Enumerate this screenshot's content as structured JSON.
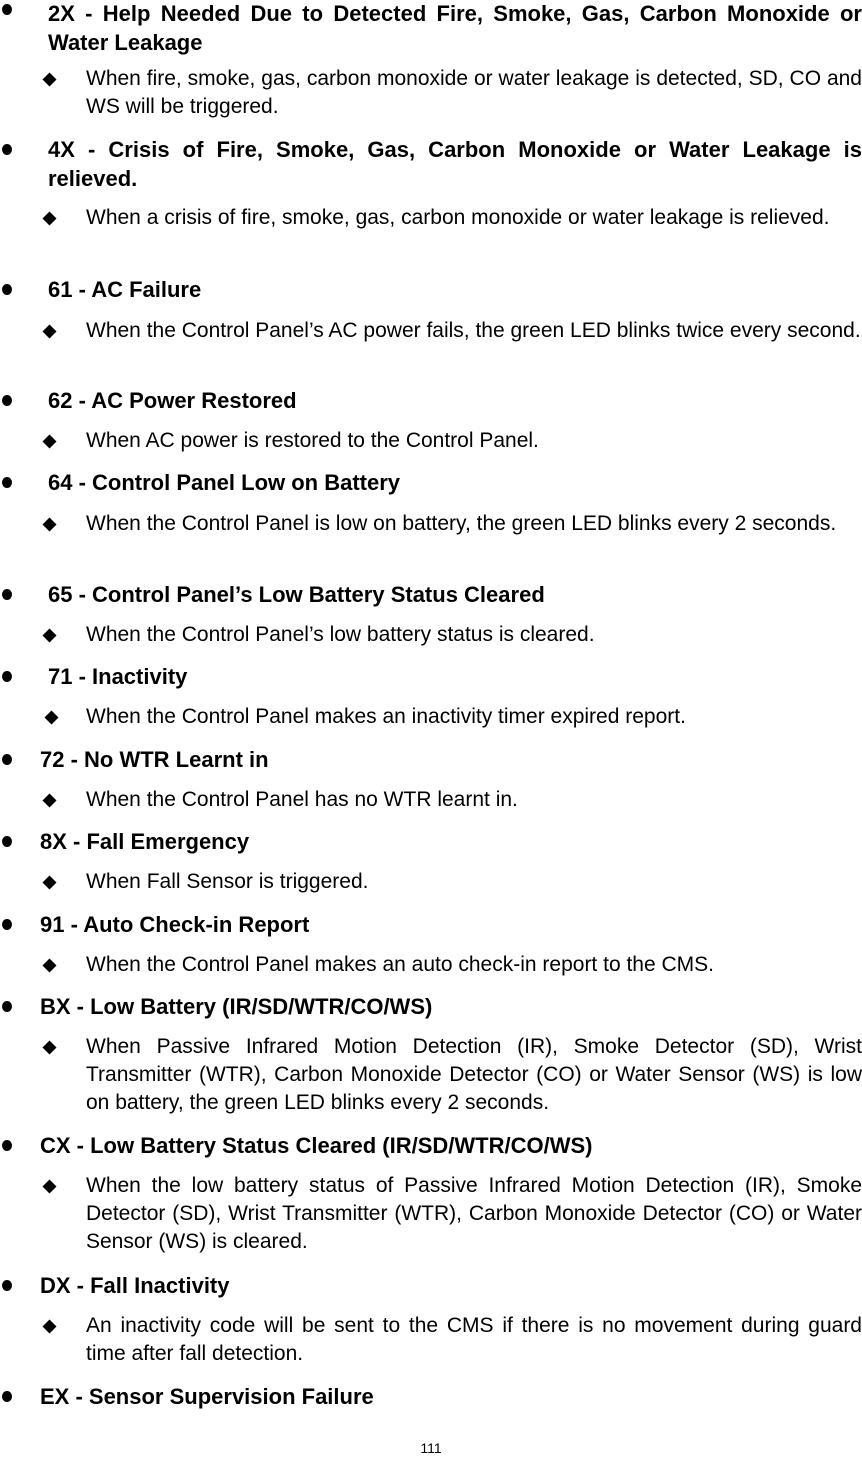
{
  "page_number": "111",
  "items": [
    {
      "code_title": "2X - Help Needed Due to Detected Fire, Smoke, Gas, Carbon Monoxide or Water Leakage",
      "description": "When fire, smoke, gas, carbon monoxide or water leakage is detected, SD, CO and WS will be triggered."
    },
    {
      "code_title": "4X - Crisis of Fire, Smoke, Gas, Carbon Monoxide or Water Leakage is relieved.",
      "description": "When a crisis of fire, smoke, gas, carbon monoxide or water leakage is relieved."
    },
    {
      "code_title": "61 - AC Failure",
      "description": "When the Control Panel’s AC power fails, the green LED blinks twice every second."
    },
    {
      "code_title": "62 - AC Power Restored",
      "description": "When AC power is restored to the Control Panel."
    },
    {
      "code_title": "64 - Control Panel Low on Battery",
      "description": "When the Control Panel is low on battery, the green LED blinks every 2 seconds."
    },
    {
      "code_title": "65 - Control Panel’s Low Battery Status Cleared",
      "description": "When the Control Panel’s low battery status is cleared."
    },
    {
      "code_title": "71 - Inactivity",
      "description": "When the Control Panel makes an inactivity timer expired report."
    },
    {
      "code_title": "72 - No WTR Learnt in",
      "description": "When the Control Panel has no WTR learnt in."
    },
    {
      "code_title": "8X - Fall Emergency",
      "description": "When Fall Sensor is triggered."
    },
    {
      "code_title": "91 - Auto Check-in Report",
      "description": "When the Control Panel makes an auto check-in report to the CMS."
    },
    {
      "code_title": "BX - Low Battery (IR/SD/WTR/CO/WS)",
      "description": "When Passive Infrared Motion Detection (IR), Smoke Detector (SD), Wrist Transmitter (WTR), Carbon Monoxide Detector (CO) or Water Sensor (WS) is low on battery, the green LED blinks every 2 seconds."
    },
    {
      "code_title": "CX - Low Battery Status Cleared (IR/SD/WTR/CO/WS)",
      "description": "When the low battery status of Passive Infrared Motion Detection (IR), Smoke Detector (SD), Wrist Transmitter (WTR), Carbon Monoxide Detector (CO) or Water Sensor (WS) is cleared."
    },
    {
      "code_title": "DX - Fall Inactivity",
      "description": "An inactivity code will be sent to the CMS if there is no movement during guard time after fall detection."
    },
    {
      "code_title": "EX - Sensor Supervision Failure"
    }
  ]
}
